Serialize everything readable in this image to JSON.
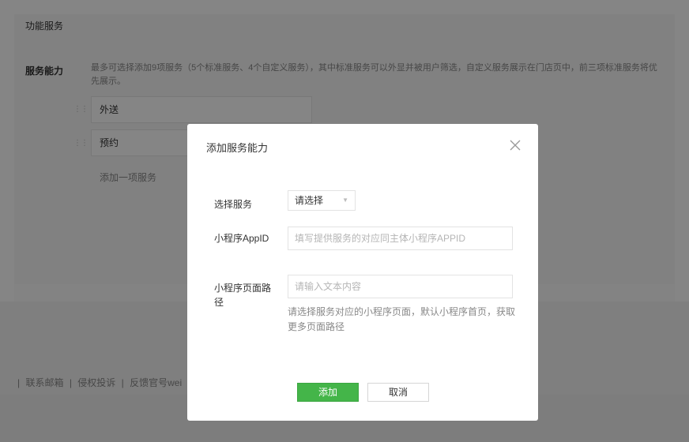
{
  "page": {
    "section_title": "功能服务",
    "ability_label": "服务能力",
    "description": "最多可选择添加9项服务（5个标准服务、4个自定义服务），其中标准服务可以外显并被用户筛选，自定义服务展示在门店页中，前三项标准服务将优先展示。",
    "services": [
      {
        "label": "外送"
      },
      {
        "label": "预约"
      }
    ],
    "add_service_label": "添加一项服务",
    "footer_links": [
      "联系邮箱",
      "侵权投诉",
      "反馈官号wei"
    ],
    "footer_separator": "|"
  },
  "dialog": {
    "title": "添加服务能力",
    "select_label": "选择服务",
    "select_value": "请选择",
    "appid_label": "小程序AppID",
    "appid_placeholder": "填写提供服务的对应同主体小程序APPID",
    "path_label": "小程序页面路径",
    "path_placeholder": "请输入文本内容",
    "path_hint": "请选择服务对应的小程序页面，默认小程序首页，获取更多页面路径",
    "add_button": "添加",
    "cancel_button": "取消"
  },
  "colors": {
    "primary": "#44b549",
    "overlay": "rgba(0,0,0,0.48)"
  }
}
